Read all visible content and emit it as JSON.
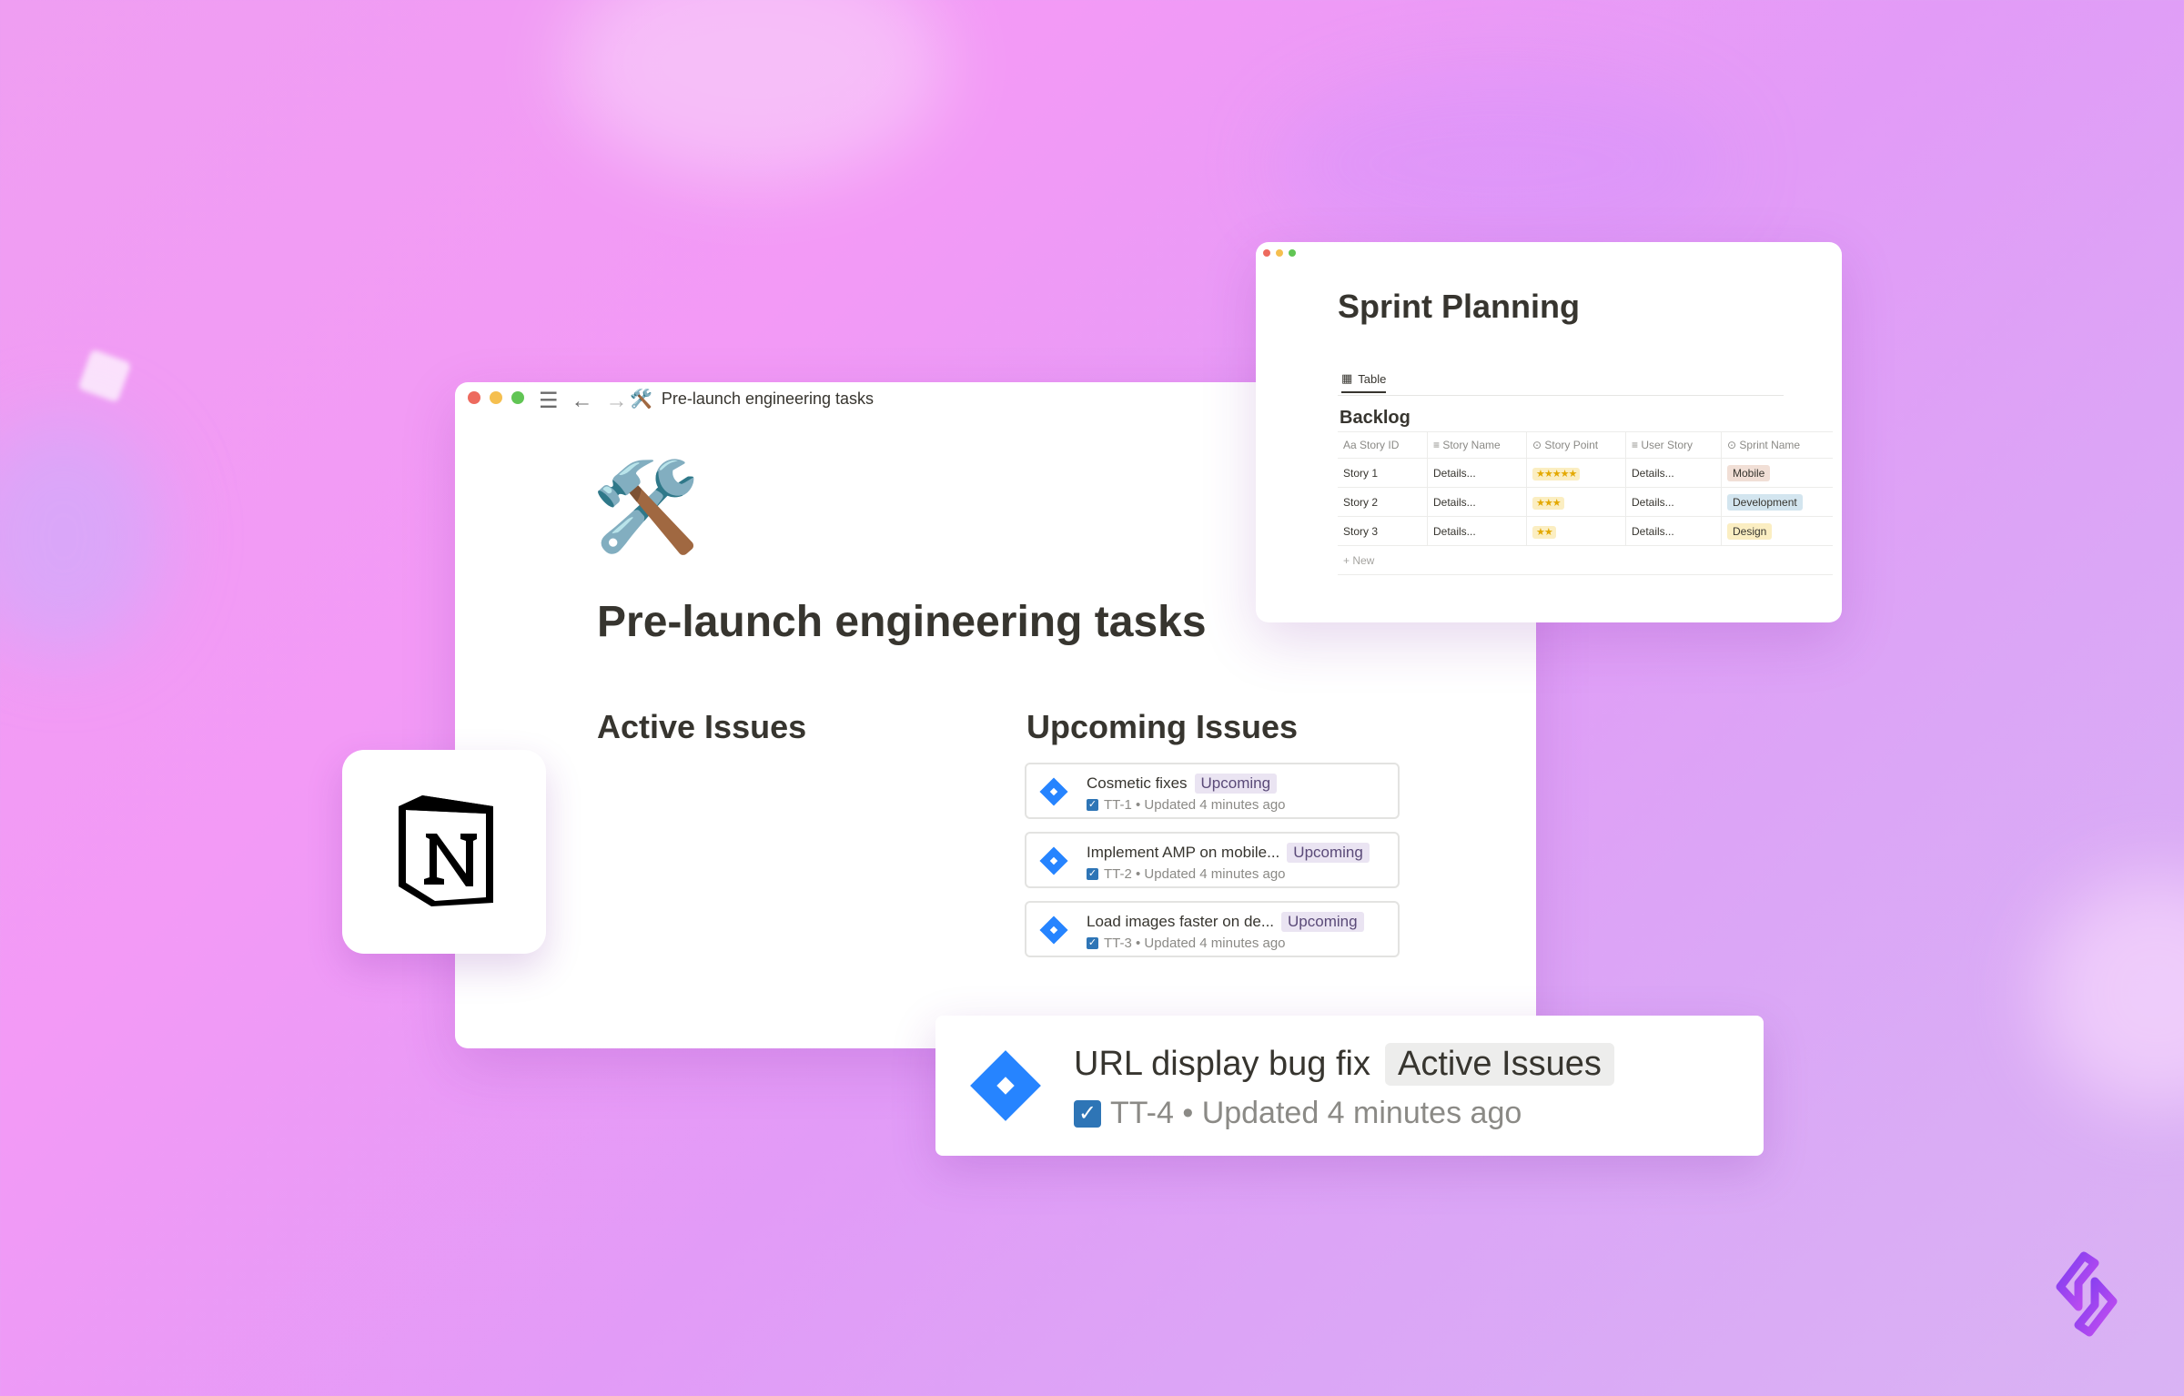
{
  "main_window": {
    "tab_title": "Pre-launch engineering tasks",
    "page_icon": "🛠️",
    "page_title": "Pre-launch engineering tasks",
    "active_heading": "Active Issues",
    "upcoming_heading": "Upcoming Issues",
    "issues": [
      {
        "name": "Cosmetic fixes",
        "status": "Upcoming",
        "meta": "TT-1 • Updated 4 minutes ago"
      },
      {
        "name": "Implement AMP on mobile...",
        "status": "Upcoming",
        "meta": "TT-2 • Updated 4 minutes ago"
      },
      {
        "name": "Load images faster on de...",
        "status": "Upcoming",
        "meta": "TT-3 • Updated 4 minutes ago"
      }
    ]
  },
  "sprint_window": {
    "title": "Sprint Planning",
    "view_tab": "Table",
    "database_title": "Backlog",
    "columns": [
      "Story ID",
      "Story Name",
      "Story Point",
      "User Story",
      "Sprint Name"
    ],
    "rows": [
      {
        "id": "Story 1",
        "name": "Details...",
        "points": "★★★★★",
        "user_story": "Details...",
        "sprint": "Mobile",
        "sprint_color": "#f1dfd6"
      },
      {
        "id": "Story 2",
        "name": "Details...",
        "points": "★★★",
        "user_story": "Details...",
        "sprint": "Development",
        "sprint_color": "#d3e5ef"
      },
      {
        "id": "Story 3",
        "name": "Details...",
        "points": "★★",
        "user_story": "Details...",
        "sprint": "Design",
        "sprint_color": "#fbeec2"
      }
    ],
    "new_row_label": "+ New"
  },
  "big_card": {
    "name": "URL display bug fix",
    "status": "Active Issues",
    "meta": "TT-4 • Updated 4 minutes ago"
  },
  "icons": [
    "hammer-and-wrench-icon",
    "notion-logo",
    "jira-icon",
    "brand-logo"
  ],
  "colors": {
    "jira_blue": "#2684ff",
    "checkbox_blue": "#2e75b6",
    "tag_purple": "#eae4f2"
  }
}
